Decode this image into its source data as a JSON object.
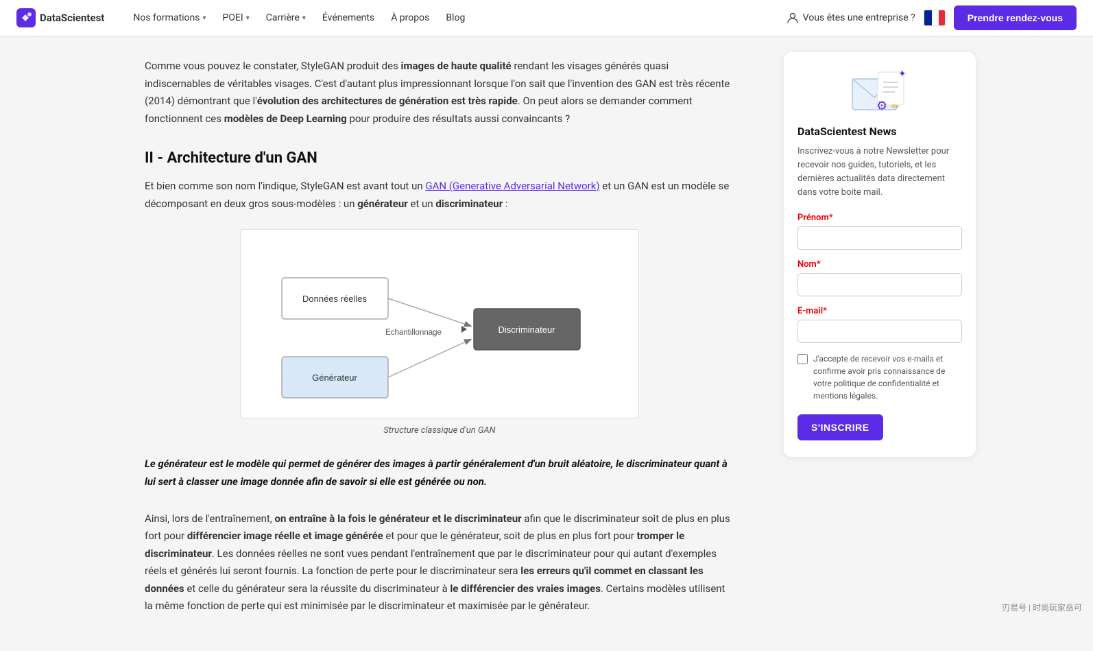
{
  "navbar": {
    "logo_text": "DataScientest",
    "nav_items": [
      {
        "label": "Nos formations",
        "has_dropdown": true
      },
      {
        "label": "POEI",
        "has_dropdown": true
      },
      {
        "label": "Carrière",
        "has_dropdown": true
      },
      {
        "label": "Événements",
        "has_dropdown": false
      },
      {
        "label": "À propos",
        "has_dropdown": false
      },
      {
        "label": "Blog",
        "has_dropdown": false
      }
    ],
    "enterprise_label": "Vous êtes une entreprise ?",
    "cta_label": "Prendre rendez-vous"
  },
  "article": {
    "intro_text_1": "Comme vous pouvez le constater, StyleGAN produit des ",
    "intro_bold_1": "images de haute qualité",
    "intro_text_2": " rendant les visages générés quasi indiscernables de véritables visages. C'est d'autant plus impressionnant lorsque l'on sait que l'invention des GAN est très récente (2014) démontrant que l'",
    "intro_bold_2": "évolution des architectures de génération est très rapide",
    "intro_text_3": ". On peut alors se demander comment fonctionnent ces ",
    "intro_bold_3": "modèles de Deep Learning",
    "intro_text_4": " pour produire des résultats aussi convaincants ?",
    "section_title": "II - Architecture d'un GAN",
    "para1_text_1": "Et bien comme son nom l'indique, StyleGAN est avant tout un ",
    "para1_link": "GAN (Generative Adversarial Network)",
    "para1_text_2": " et un GAN est un modèle se décomposant en deux gros sous-modèles : un ",
    "para1_bold_1": "générateur",
    "para1_text_3": " et un ",
    "para1_bold_2": "discriminateur",
    "para1_text_4": " :",
    "diagram_caption": "Structure classique d'un GAN",
    "diagram_nodes": {
      "donnees_label": "Données réelles",
      "echantillonnage_label": "Echantillonnage",
      "discriminateur_label": "Discriminateur",
      "generateur_label": "Générateur"
    },
    "blockquote": "Le générateur est le modèle qui permet de générer des images à partir généralement d'un bruit aléatoire, le discriminateur quant à lui sert à classer une image donnée afin de savoir si elle est générée ou non.",
    "para2_text_1": "Ainsi, lors de l'entraînement, ",
    "para2_bold_1": "on entraîne à la fois le générateur et le discriminateur",
    "para2_text_2": " afin que le discriminateur soit de plus en plus fort pour ",
    "para2_bold_2": "différencier image réelle et image générée",
    "para2_text_3": " et pour que le générateur, soit de plus en plus fort pour ",
    "para2_bold_3": "tromper le discriminateur",
    "para2_text_4": ". Les données réelles ne sont vues pendant l'entraînement que par le discriminateur pour qui autant d'exemples réels et générés lui seront fournis. La fonction de perte pour le discriminateur sera ",
    "para2_bold_4": "les erreurs qu'il commet en classant les données",
    "para2_text_5": " et celle du générateur sera la réussite du discriminateur à ",
    "para2_bold_5": "le différencier des vraies images",
    "para2_text_6": ". Certains modèles utilisent la même fonction de perte qui est minimisée par le discriminateur et maximisée par le générateur."
  },
  "sidebar": {
    "newsletter_title": "DataScientest News",
    "newsletter_desc": "Inscrivez-vous à notre Newsletter pour recevoir nos guides, tutoriels, et les dernières actualités data directement dans votre boite mail.",
    "prenom_label": "Prénom",
    "nom_label": "Nom",
    "email_label": "E-mail",
    "checkbox_label": "J'accepte de recevoir vos e-mails et confirme avoir pris connaissance de votre politique de confidentialité et mentions légales.",
    "subscribe_label": "S'INSCRIRE"
  },
  "watermark": "刃易号 | 时尚玩家岳可"
}
